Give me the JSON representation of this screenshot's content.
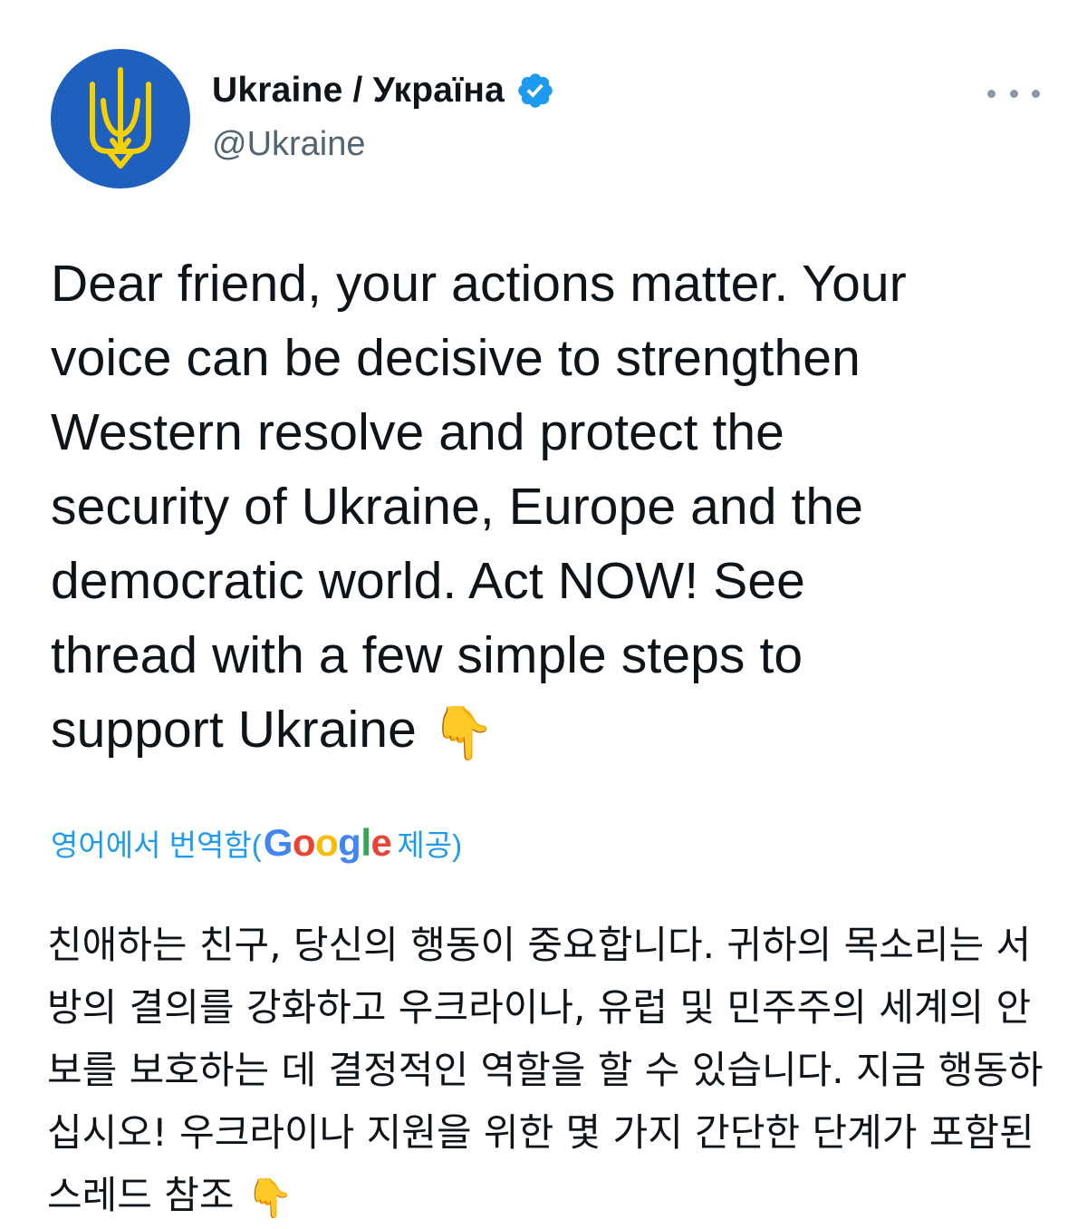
{
  "account": {
    "display_name": "Ukraine / Україна",
    "handle": "@Ukraine",
    "verified": true,
    "avatar_icon": "trident-coat-of-arms-icon",
    "avatar_bg": "#1f5fbd",
    "avatar_fg": "#f5d000"
  },
  "actions": {
    "more_icon": "more-horizontal-icon"
  },
  "tweet": {
    "text": "Dear friend, your actions matter. Your\nvoice can be decisive to strengthen\nWestern resolve and protect the\nsecurity of Ukraine, Europe and the\ndemocratic world. Act NOW! See\nthread with a few simple steps to\nsupport Ukraine",
    "emoji": "👇"
  },
  "translation": {
    "label_before": "영어에서 번역함(",
    "provider": "Google",
    "label_after": " 제공)",
    "text": "친애하는 친구, 당신의 행동이 중요합니다. 귀하의 목소리는 서\n방의 결의를 강화하고 우크라이나, 유럽 및 민주주의 세계의 안\n보를 보호하는 데 결정적인 역할을 할 수 있습니다. 지금 행동하\n십시오! 우크라이나 지원을 위한 몇 가지 간단한 단계가 포함된\n스레드 참조",
    "emoji": "👇"
  },
  "colors": {
    "link": "#1d9bf0",
    "verified_badge": "#1d9bf0",
    "secondary_text": "#536471"
  }
}
